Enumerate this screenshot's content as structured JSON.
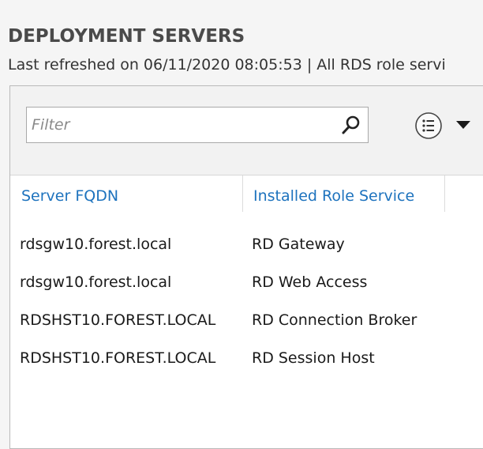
{
  "section": {
    "title": "DEPLOYMENT SERVERS",
    "subtitle": "Last refreshed on 06/11/2020 08:05:53 | All RDS role servi"
  },
  "toolbar": {
    "filter_placeholder": "Filter",
    "search_icon": "search-icon",
    "view_icon": "list-view-icon",
    "dropdown_icon": "caret-down-icon"
  },
  "table": {
    "columns": [
      "Server FQDN",
      "Installed Role Service"
    ],
    "rows": [
      {
        "server": "rdsgw10.forest.local",
        "role": "RD Gateway"
      },
      {
        "server": "rdsgw10.forest.local",
        "role": "RD Web Access"
      },
      {
        "server": "RDSHST10.FOREST.LOCAL",
        "role": "RD Connection Broker"
      },
      {
        "server": "RDSHST10.FOREST.LOCAL",
        "role": "RD Session Host"
      }
    ]
  },
  "colors": {
    "header_link": "#1e73be",
    "title_text": "#4a4a4a",
    "toolbar_bg": "#f2f2f2"
  }
}
